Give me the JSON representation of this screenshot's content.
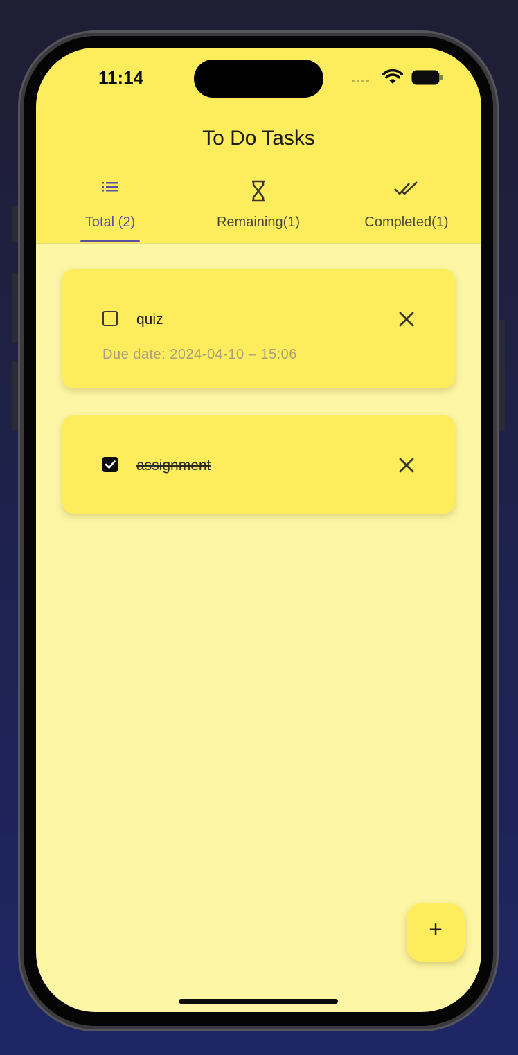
{
  "status_bar": {
    "time": "11:14"
  },
  "app_bar": {
    "title": "To Do Tasks"
  },
  "tabs": [
    {
      "label": "Total (2)",
      "icon": "list-icon",
      "active": true
    },
    {
      "label": "Remaining(1)",
      "icon": "hourglass-icon",
      "active": false
    },
    {
      "label": "Completed(1)",
      "icon": "done-all-icon",
      "active": false
    }
  ],
  "tasks": [
    {
      "title": "quiz",
      "completed": false,
      "due": "Due date: 2024-04-10 – 15:06"
    },
    {
      "title": "assignment",
      "completed": true
    }
  ],
  "fab": {
    "label": "+"
  },
  "colors": {
    "app_bar": "#fdec5c",
    "background": "#fdf6a4",
    "accent": "#5b4fa0",
    "due_text": "#a9a07b"
  }
}
